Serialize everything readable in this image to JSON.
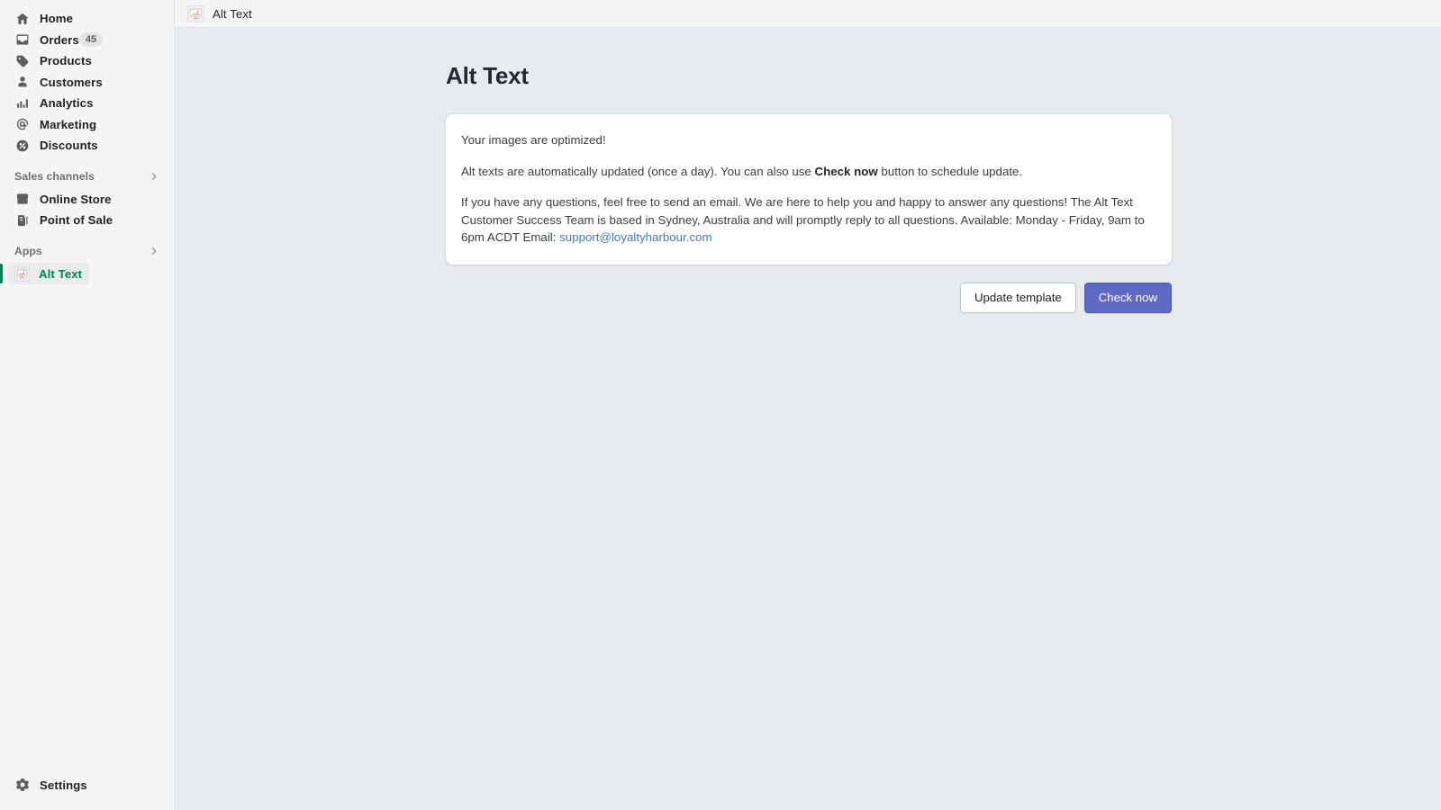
{
  "sidebar": {
    "primary_items": [
      {
        "label": "Home",
        "icon": "home-icon",
        "badge": null
      },
      {
        "label": "Orders",
        "icon": "orders-icon",
        "badge": "45"
      },
      {
        "label": "Products",
        "icon": "products-icon",
        "badge": null
      },
      {
        "label": "Customers",
        "icon": "customers-icon",
        "badge": null
      },
      {
        "label": "Analytics",
        "icon": "analytics-icon",
        "badge": null
      },
      {
        "label": "Marketing",
        "icon": "marketing-icon",
        "badge": null
      },
      {
        "label": "Discounts",
        "icon": "discounts-icon",
        "badge": null
      }
    ],
    "sales_channels": {
      "title": "Sales channels",
      "chevron": "chevron-right-icon",
      "items": [
        {
          "label": "Online Store",
          "icon": "online-store-icon"
        },
        {
          "label": "Point of Sale",
          "icon": "point-of-sale-icon"
        }
      ]
    },
    "apps": {
      "title": "Apps",
      "chevron": "chevron-right-icon",
      "items": [
        {
          "label": "Alt Text",
          "icon": "alt-text-app-icon",
          "selected": true
        }
      ]
    },
    "settings": {
      "label": "Settings",
      "icon": "gear-icon"
    },
    "colors": {
      "background": "#f5f5f5",
      "selected_accent": "#007b5c",
      "selected_text": "#007f5f",
      "badge_background": "#e4e5e7"
    }
  },
  "topbar": {
    "app_icon": "alt-text-app-icon",
    "title": "Alt Text"
  },
  "main": {
    "page_title": "Alt Text",
    "card": {
      "paragraph_1": "Your images are optimized!",
      "paragraph_2_before": "Alt texts are automatically updated (once a day). You can also use ",
      "paragraph_2_bold": "Check now",
      "paragraph_2_after": " button to schedule update.",
      "paragraph_3": "If you have any questions, feel free to send an email. We are here to help you and happy to answer any questions! The Alt Text Customer Success Team is based in Sydney, Australia and will promptly reply to all questions. Available: Monday - Friday, 9am to 6pm ACDT Email: ",
      "support_email": "support@loyaltyharbour.com"
    },
    "actions": {
      "secondary_label": "Update template",
      "primary_label": "Check now"
    },
    "colors": {
      "page_background": "#e8ebed",
      "card_background": "#ffffff",
      "primary_button": "#5c6ac4",
      "link": "#3b7bbf",
      "title": "#202a37"
    }
  }
}
